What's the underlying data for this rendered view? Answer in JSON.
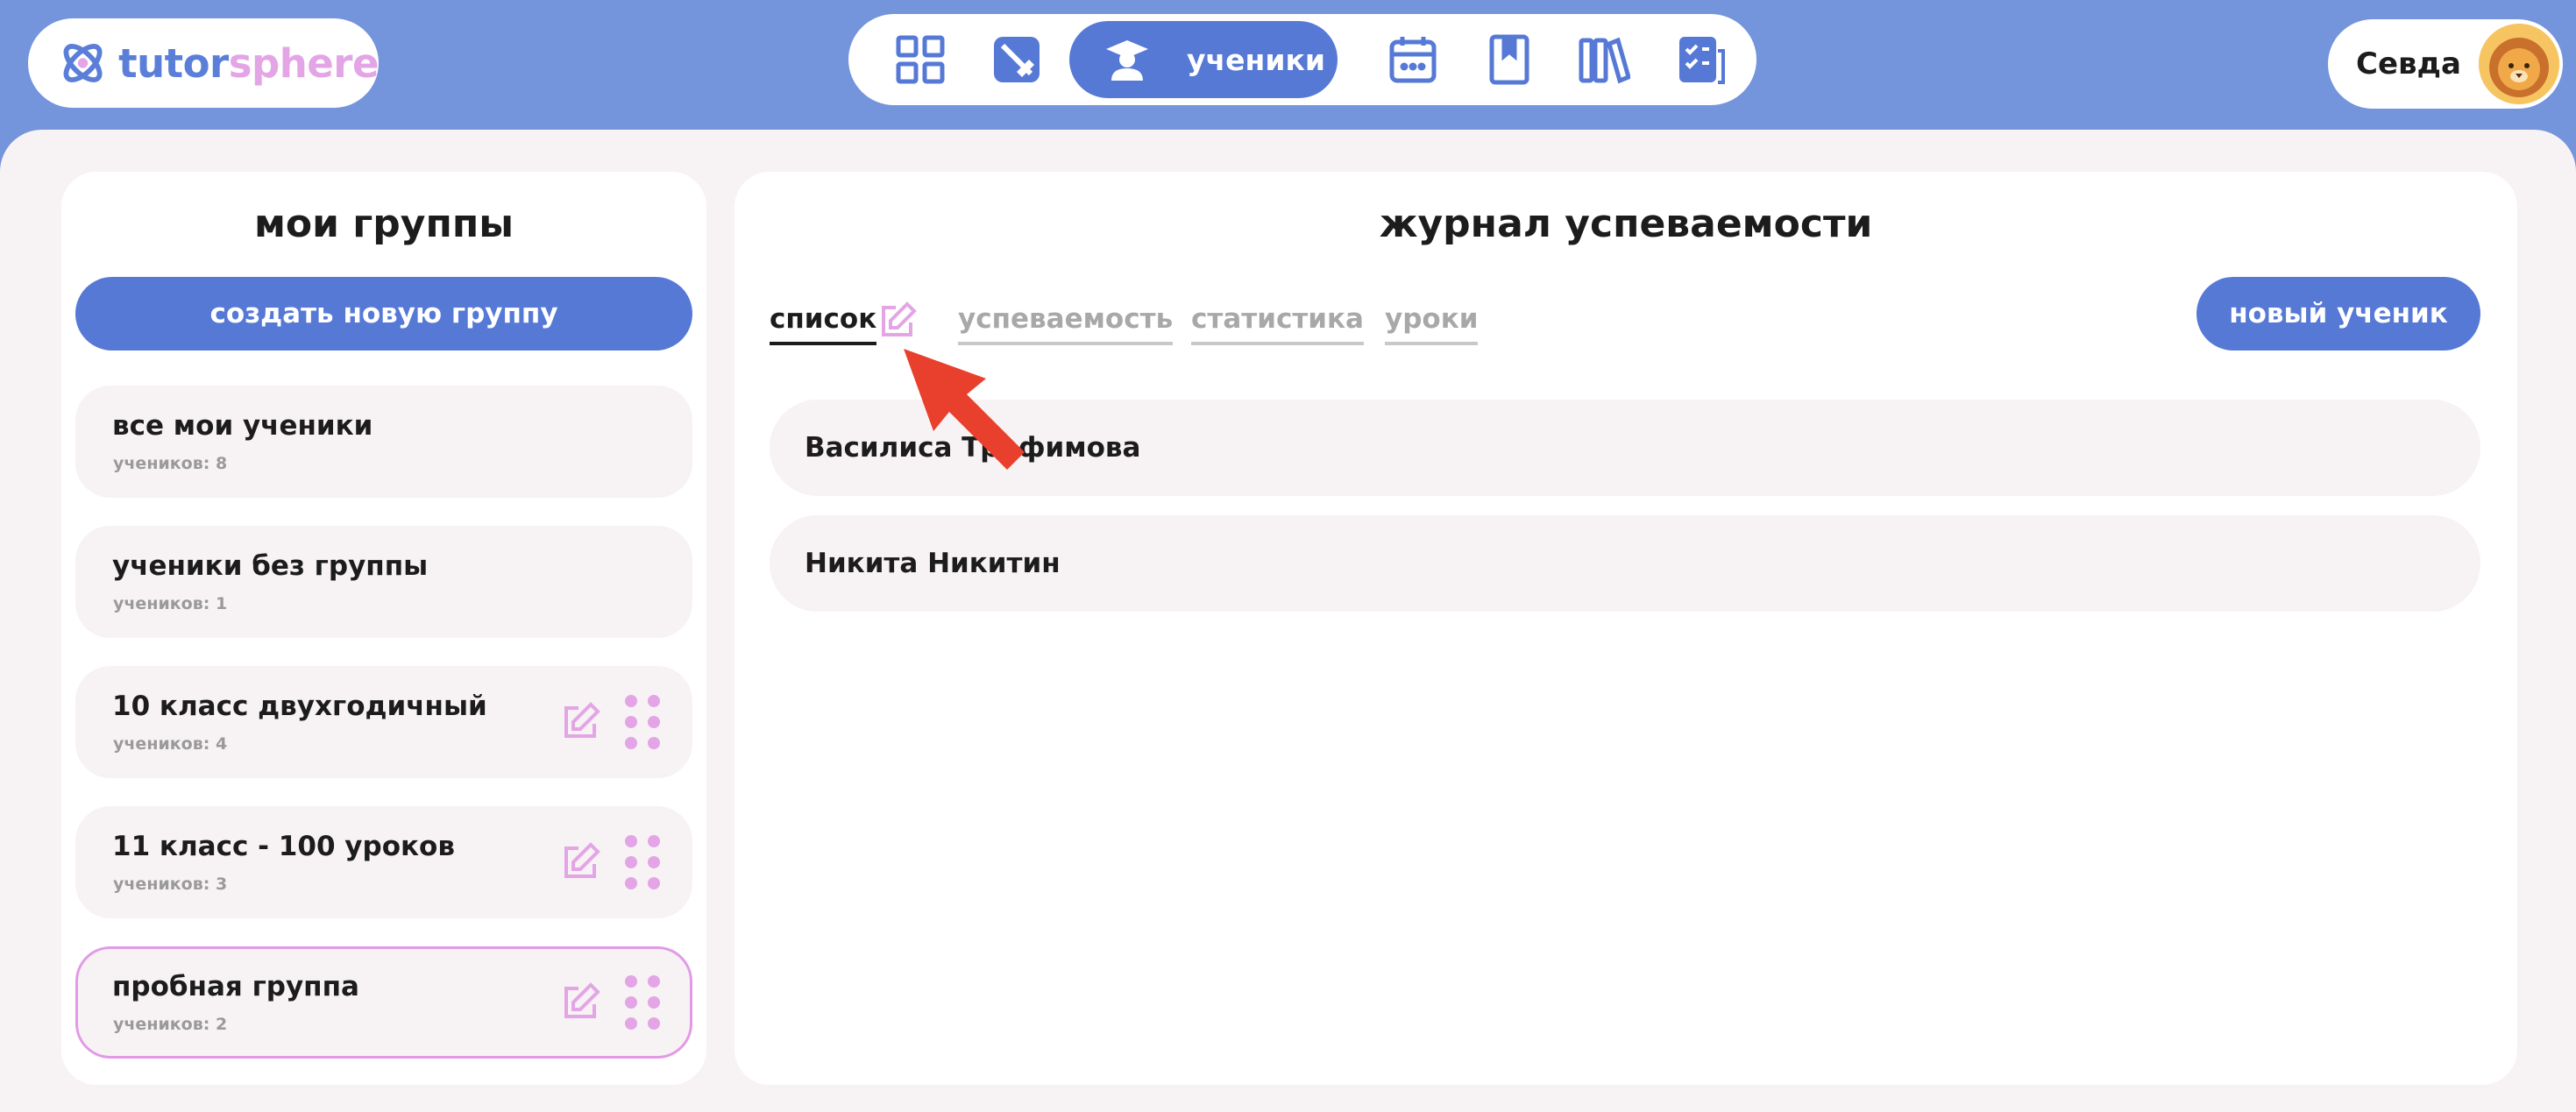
{
  "app": {
    "logo_part1": "tutor",
    "logo_part2": "sphere"
  },
  "nav": {
    "items": [
      "dashboard-icon",
      "no-pen-icon",
      "students-icon",
      "calendar-icon",
      "book-icon",
      "library-icon",
      "homework-icon"
    ],
    "active_label": "ученики"
  },
  "user": {
    "name": "Севда",
    "avatar": "lion-avatar"
  },
  "groups_panel": {
    "title": "мои группы",
    "create_button": "создать новую группу",
    "groups": [
      {
        "name": "все мои ученики",
        "count": "учеников: 8"
      },
      {
        "name": "ученики без группы",
        "count": "учеников: 1"
      },
      {
        "name": "10 класс двухгодичный",
        "count": "учеников: 4"
      },
      {
        "name": "11 класс - 100 уроков",
        "count": "учеников: 3"
      },
      {
        "name": "пробная группа",
        "count": "учеников: 2"
      }
    ]
  },
  "journal": {
    "title": "журнал успеваемости",
    "tabs": [
      "список",
      "успеваемость",
      "статистика",
      "уроки"
    ],
    "active_tab": "список",
    "new_student_button": "новый ученик",
    "students": [
      "Василиса Трофимова",
      "Никита Никитин"
    ]
  },
  "colors": {
    "header_bg": "#7494dc",
    "accent": "#5679d6",
    "pink": "#e3a5e6",
    "content_bg": "#f7f2f4",
    "arrow": "#e8402c"
  }
}
